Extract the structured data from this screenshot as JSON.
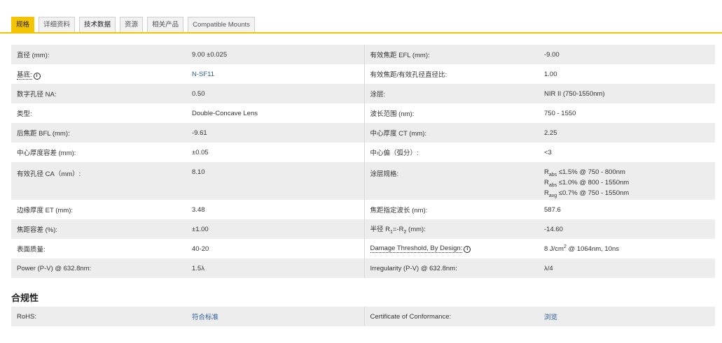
{
  "tabs": [
    {
      "label": "规格"
    },
    {
      "label": "详细资料"
    },
    {
      "label": "技术数据"
    },
    {
      "label": "资源"
    },
    {
      "label": "相关产品"
    },
    {
      "label": "Compatible Mounts"
    }
  ],
  "specs": [
    {
      "l1": "直径 (mm):",
      "v1": "9.00 ±0.025",
      "l2": "有效焦距 EFL (mm):",
      "v2": "-9.00"
    },
    {
      "l1": "基底:",
      "v1": "N-SF11",
      "l2": "有效焦距/有效孔径直径比:",
      "v2": "1.00"
    },
    {
      "l1": "数字孔径 NA:",
      "v1": "0.50",
      "l2": "涂层:",
      "v2": "NIR II (750-1550nm)"
    },
    {
      "l1": "类型:",
      "v1": "Double-Concave Lens",
      "l2": "波长范围 (nm):",
      "v2": "750 - 1550"
    },
    {
      "l1": "后焦距 BFL (mm):",
      "v1": "-9.61",
      "l2": "中心厚度 CT (mm):",
      "v2": "2.25"
    },
    {
      "l1": "中心厚度容差 (mm):",
      "v1": "±0.05",
      "l2": "中心偏（弧分）:",
      "v2": "<3"
    },
    {
      "l1": "有效孔径 CA（mm）:",
      "v1": "8.10",
      "l2": "涂层规格:",
      "v2_lines": [
        {
          "sym": "R",
          "sub": "abs",
          "text": "≤1.5% @ 750 - 800nm"
        },
        {
          "sym": "R",
          "sub": "abs",
          "text": "≤1.0% @ 800 - 1550nm"
        },
        {
          "sym": "R",
          "sub": "avg",
          "text": "≤0.7% @ 750 - 1550nm"
        }
      ]
    },
    {
      "l1": "边缘厚度 ET (mm):",
      "v1": "3.48",
      "l2": "焦距指定波长 (nm):",
      "v2": "587.6"
    },
    {
      "l1": "焦距容差 (%):",
      "v1": "±1.00",
      "l2_prefix": "半径 R",
      "l2_sub1": "1",
      "l2_mid": "=-R",
      "l2_sub2": "2",
      "l2_suffix": " (mm):",
      "v2": "-14.60"
    },
    {
      "l1": "表面质量:",
      "v1": "40-20",
      "l2": "Damage Threshold, By Design:",
      "v2_prefix": "8 J/cm",
      "v2_sup": "2",
      "v2_suffix": " @ 1064nm, 10ns"
    },
    {
      "l1": "Power (P-V) @ 632.8nm:",
      "v1": "1.5λ",
      "l2": "Irregularity (P-V) @ 632.8nm:",
      "v2": "λ/4"
    }
  ],
  "compliance": {
    "title": "合规性",
    "rows": [
      {
        "l1": "RoHS:",
        "v1": "符合标准",
        "l2": "Certificate of Conformance:",
        "v2": "浏览"
      }
    ]
  },
  "info_icon_glyph": "i",
  "colors": {
    "accent": "#f5c400",
    "link": "#2a5d9c",
    "row_shade": "#ededed"
  }
}
